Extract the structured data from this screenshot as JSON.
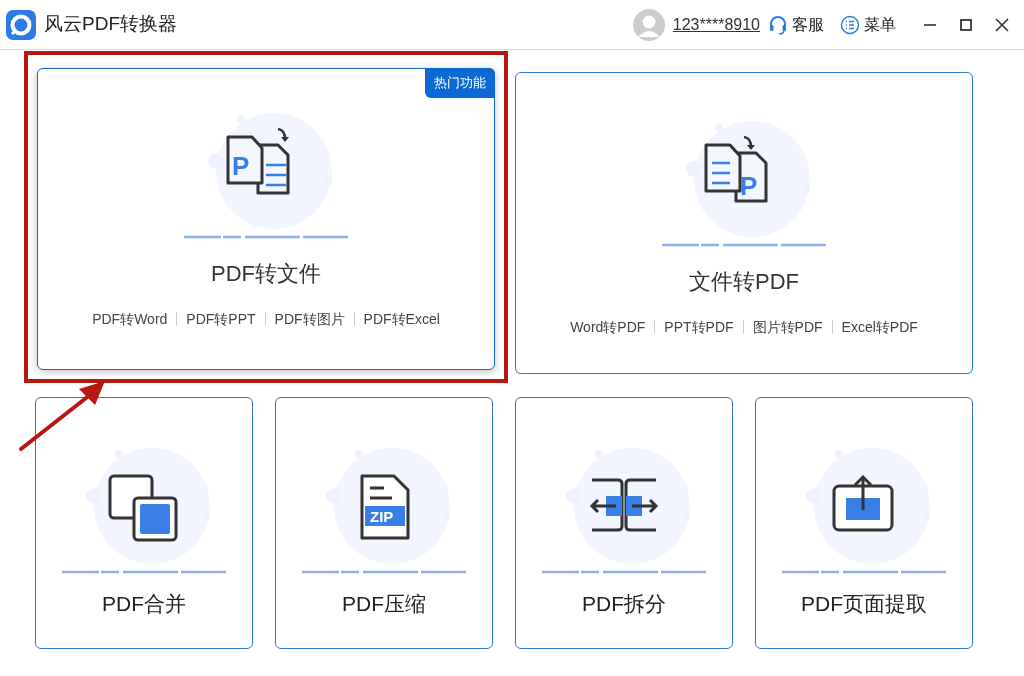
{
  "app": {
    "title": "风云PDF转换器"
  },
  "header": {
    "account": "123****8910",
    "service": "客服",
    "menu": "菜单"
  },
  "feature_cards": [
    {
      "kind": "pdf-to-file",
      "icon_text": "P",
      "title": "PDF转文件",
      "badge": "热门功能",
      "highlighted": true,
      "links": [
        "PDF转Word",
        "PDF转PPT",
        "PDF转图片",
        "PDF转Excel"
      ]
    },
    {
      "kind": "file-to-pdf",
      "icon_text": "P",
      "title": "文件转PDF",
      "highlighted": false,
      "links": [
        "Word转PDF",
        "PPT转PDF",
        "图片转PDF",
        "Excel转PDF"
      ]
    }
  ],
  "tool_cards": [
    {
      "kind": "merge",
      "title": "PDF合并"
    },
    {
      "kind": "zip",
      "icon_text": "ZIP",
      "title": "PDF压缩"
    },
    {
      "kind": "split",
      "title": "PDF拆分"
    },
    {
      "kind": "extract",
      "title": "PDF页面提取"
    }
  ]
}
